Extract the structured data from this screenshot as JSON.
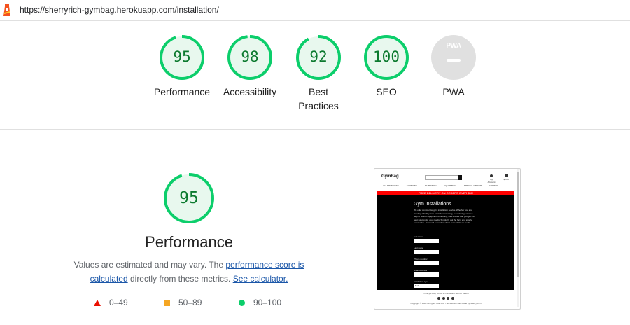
{
  "url": "https://sherryrich-gymbag.herokuapp.com/installation/",
  "colors": {
    "pass": "#0cce6b",
    "pass_text": "#0c7a2f",
    "average": "#f5a623",
    "fail": "#eb0f00",
    "pwa_gray": "#e0e0e0"
  },
  "gauges": [
    {
      "label": "Performance",
      "score": "95",
      "value": 95
    },
    {
      "label": "Accessibility",
      "score": "98",
      "value": 98
    },
    {
      "label": "Best Practices",
      "score": "92",
      "value": 92
    },
    {
      "label": "SEO",
      "score": "100",
      "value": 100
    },
    {
      "label": "PWA",
      "badge": "PWA"
    }
  ],
  "performance": {
    "score": "95",
    "value": 95,
    "title": "Performance",
    "desc_prefix": "Values are estimated and may vary. The ",
    "link1": "performance score is calculated",
    "desc_middle": " directly from these metrics. ",
    "link2": "See calculator."
  },
  "legend": [
    {
      "range": "0–49",
      "icon": "triangle-icon"
    },
    {
      "range": "50–89",
      "icon": "square-icon"
    },
    {
      "range": "90–100",
      "icon": "circle-icon"
    }
  ],
  "thumb": {
    "brand": "GymBag",
    "account": "My Account",
    "bag_total": "$0.00",
    "nav": [
      "ALL PRODUCTS",
      "CLOTHING",
      "NUTRITION",
      "EQUIPMENT",
      "SPECIAL OFFERS",
      "MORE ▾"
    ],
    "banner": "FREE DELIVERY ON ORDERS OVER $50!",
    "heading": "Gym Installations",
    "paragraph": "We offer commercial gym installation service. Whether you are creating a facility from scratch, renovating, refurbishing, or even help to source equipment or flooring, we'll ensure that you get the best solution for your needs. Simply fill out the form and simply select table. Here and a member of our team will be in touch.",
    "fields": [
      "Full name",
      "Last name",
      "Phone number",
      "Email Address",
      "Installation type"
    ],
    "select_value": "Both",
    "footer_links": "Privacy Policy   Terms & Conditions   Submit Return",
    "copyright": "Copyright © 2021 All rights reserved. This website was made by Sherry Rich"
  }
}
